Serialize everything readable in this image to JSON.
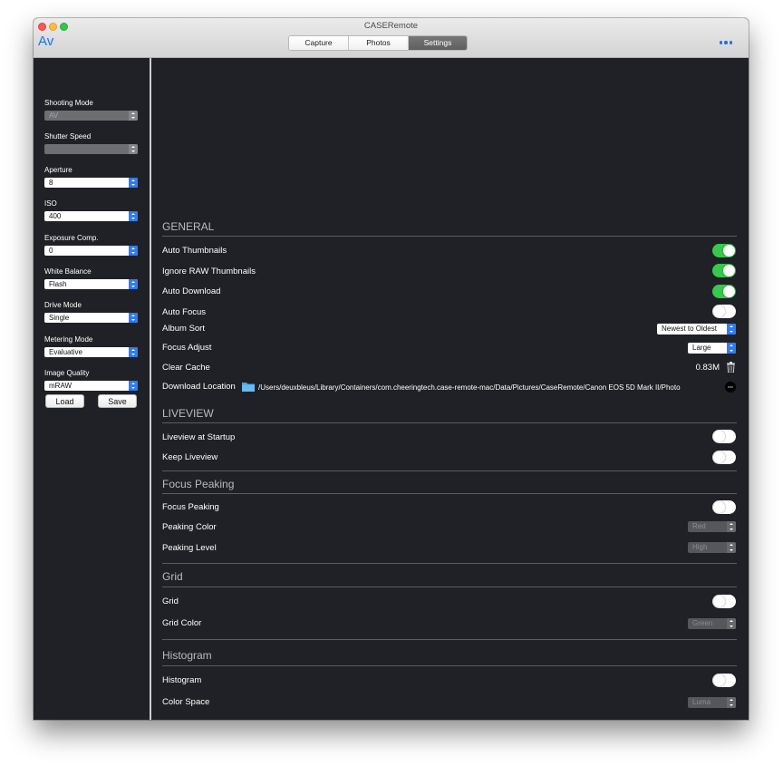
{
  "window": {
    "title": "CASERemote",
    "mode": "Av",
    "tabs": [
      {
        "label": "Capture",
        "active": false
      },
      {
        "label": "Photos",
        "active": false
      },
      {
        "label": "Settings",
        "active": true
      }
    ],
    "more_icon": "ellipsis-icon",
    "accent_color": "#1a73e8"
  },
  "sidebar": {
    "fields": [
      {
        "label": "Shooting Mode",
        "value": "AV",
        "disabled": true
      },
      {
        "label": "Shutter Speed",
        "value": "",
        "disabled": true
      },
      {
        "label": "Aperture",
        "value": "8",
        "disabled": false
      },
      {
        "label": "ISO",
        "value": "400",
        "disabled": false
      },
      {
        "label": "Exposure Comp.",
        "value": "0",
        "disabled": false
      },
      {
        "label": "White Balance",
        "value": "Flash",
        "disabled": false
      },
      {
        "label": "Drive Mode",
        "value": "Single",
        "disabled": false
      },
      {
        "label": "Metering Mode",
        "value": "Evaluative",
        "disabled": false
      },
      {
        "label": "Image Quality",
        "value": "mRAW",
        "disabled": false
      }
    ],
    "load_label": "Load",
    "save_label": "Save"
  },
  "settings": {
    "general": {
      "title": "GENERAL",
      "auto_thumbnails": {
        "label": "Auto Thumbnails",
        "on": true
      },
      "ignore_raw": {
        "label": "Ignore RAW Thumbnails",
        "on": true
      },
      "auto_download": {
        "label": "Auto Download",
        "on": true
      },
      "auto_focus": {
        "label": "Auto Focus",
        "on": false
      },
      "album_sort": {
        "label": "Album Sort",
        "value": "Newest to Oldest"
      },
      "focus_adjust": {
        "label": "Focus Adjust",
        "value": "Large"
      },
      "clear_cache": {
        "label": "Clear Cache",
        "size": "0.83M"
      },
      "download_location": {
        "label": "Download Location",
        "path": "/Users/deuxbleus/Library/Containers/com.cheeringtech.case-remote-mac/Data/Pictures/CaseRemote/Canon EOS 5D Mark II/Photo"
      }
    },
    "liveview": {
      "title": "LIVEVIEW",
      "at_startup": {
        "label": "Liveview at Startup",
        "on": false
      },
      "keep": {
        "label": "Keep Liveview",
        "on": false
      }
    },
    "focus_peaking": {
      "title": "Focus Peaking",
      "toggle": {
        "label": "Focus Peaking",
        "on": false
      },
      "color": {
        "label": "Peaking Color",
        "value": "Red"
      },
      "level": {
        "label": "Peaking Level",
        "value": "High"
      }
    },
    "grid": {
      "title": "Grid",
      "toggle": {
        "label": "Grid",
        "on": false
      },
      "color": {
        "label": "Grid Color",
        "value": "Green"
      }
    },
    "histogram": {
      "title": "Histogram",
      "toggle": {
        "label": "Histogram",
        "on": false
      },
      "color_space": {
        "label": "Color Space",
        "value": "Luma"
      }
    }
  }
}
